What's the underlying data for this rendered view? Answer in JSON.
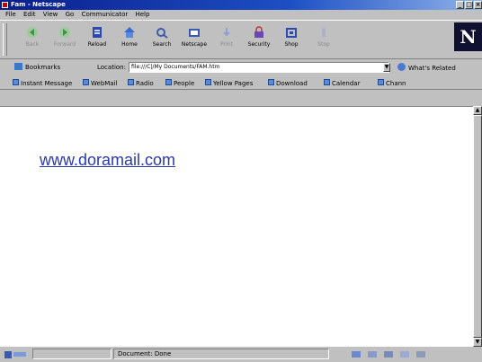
{
  "window": {
    "title": "Fam - Netscape"
  },
  "menu": [
    "File",
    "Edit",
    "View",
    "Go",
    "Communicator",
    "Help"
  ],
  "toolbar": {
    "buttons": [
      {
        "label": "Back",
        "icon": "back-arrow-icon",
        "enabled": false
      },
      {
        "label": "Forward",
        "icon": "forward-arrow-icon",
        "enabled": false
      },
      {
        "label": "Reload",
        "icon": "reload-icon",
        "enabled": true
      },
      {
        "label": "Home",
        "icon": "home-icon",
        "enabled": true
      },
      {
        "label": "Search",
        "icon": "search-icon",
        "enabled": true
      },
      {
        "label": "Netscape",
        "icon": "netscape-icon",
        "enabled": true
      },
      {
        "label": "Print",
        "icon": "print-icon",
        "enabled": false
      },
      {
        "label": "Security",
        "icon": "security-icon",
        "enabled": true
      },
      {
        "label": "Shop",
        "icon": "shop-icon",
        "enabled": true
      },
      {
        "label": "Stop",
        "icon": "stop-icon",
        "enabled": false
      }
    ],
    "logo": "N"
  },
  "location": {
    "bookmarks_label": "Bookmarks",
    "location_label": "Location:",
    "url": "file:///C|/My Documents/FAM.htm",
    "related_label": "What's Related"
  },
  "personal_toolbar": [
    "Instant Message",
    "WebMail",
    "Radio",
    "People",
    "Yellow Pages",
    "Download",
    "Calendar",
    "Chann"
  ],
  "content": {
    "link_text": "www.doramail.com"
  },
  "status": {
    "text": "Document: Done"
  },
  "colors": {
    "titlebar": "#0a1e8c",
    "link": "#2a3aa8",
    "chrome": "#c0c0c0"
  }
}
